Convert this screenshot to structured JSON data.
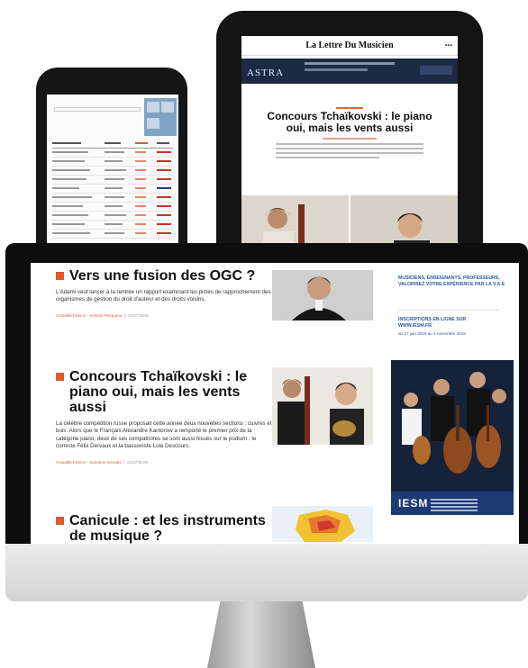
{
  "tablet": {
    "logo": "La Lettre Du Musicien",
    "banner_word": "ASTRA",
    "article_title": "Concours Tchaïkovski : le piano oui, mais les vents aussi"
  },
  "phone": {},
  "monitor": {
    "articles": [
      {
        "title": "Vers une fusion des OGC ?",
        "body": "L'Adami veut lancer à la rentrée un rapport examinant les pistes de rapprochement des organismes de gestion du droit d'auteur et des droits voisins.",
        "meta_author": "Actualité France · Antoine Pecqueur",
        "meta_date": "21/07/2019"
      },
      {
        "title": "Concours Tchaïkovski : le piano oui, mais les vents aussi",
        "body": "La célèbre compétition russe proposait cette année deux nouvelles sections : cuivres et bois. Alors que le Français Alexandre Kantorow a remporté le premier prix de la catégorie piano, deux de ses compatriotes se sont aussi hissés sur le podium : le corniste Félix Dervaux et la bassoniste Lola Descours.",
        "meta_author": "Actualité France · Suzanne Gervais",
        "meta_date": "21/07/2019"
      },
      {
        "title": "Canicule : et les instruments de musique ?",
        "body": "",
        "meta_author": "",
        "meta_date": ""
      }
    ],
    "sidebar": {
      "promo1": "MUSICIENS, ENSEIGNANTS, PROFESSEURS, VALORISEZ VOTRE EXPÉRIENCE PAR LA V.A.E",
      "promo2": "INSCRIPTIONS EN LIGNE SUR WWW.IESM.FR",
      "promo2_dates": "du 17 juin 2019 au 4 novembre 2019",
      "ad_logo": "IESM"
    }
  },
  "colors": {
    "accent": "#e05a2b",
    "sidebar_blue": "#2a5aa0",
    "ad_navy": "#17263d"
  }
}
